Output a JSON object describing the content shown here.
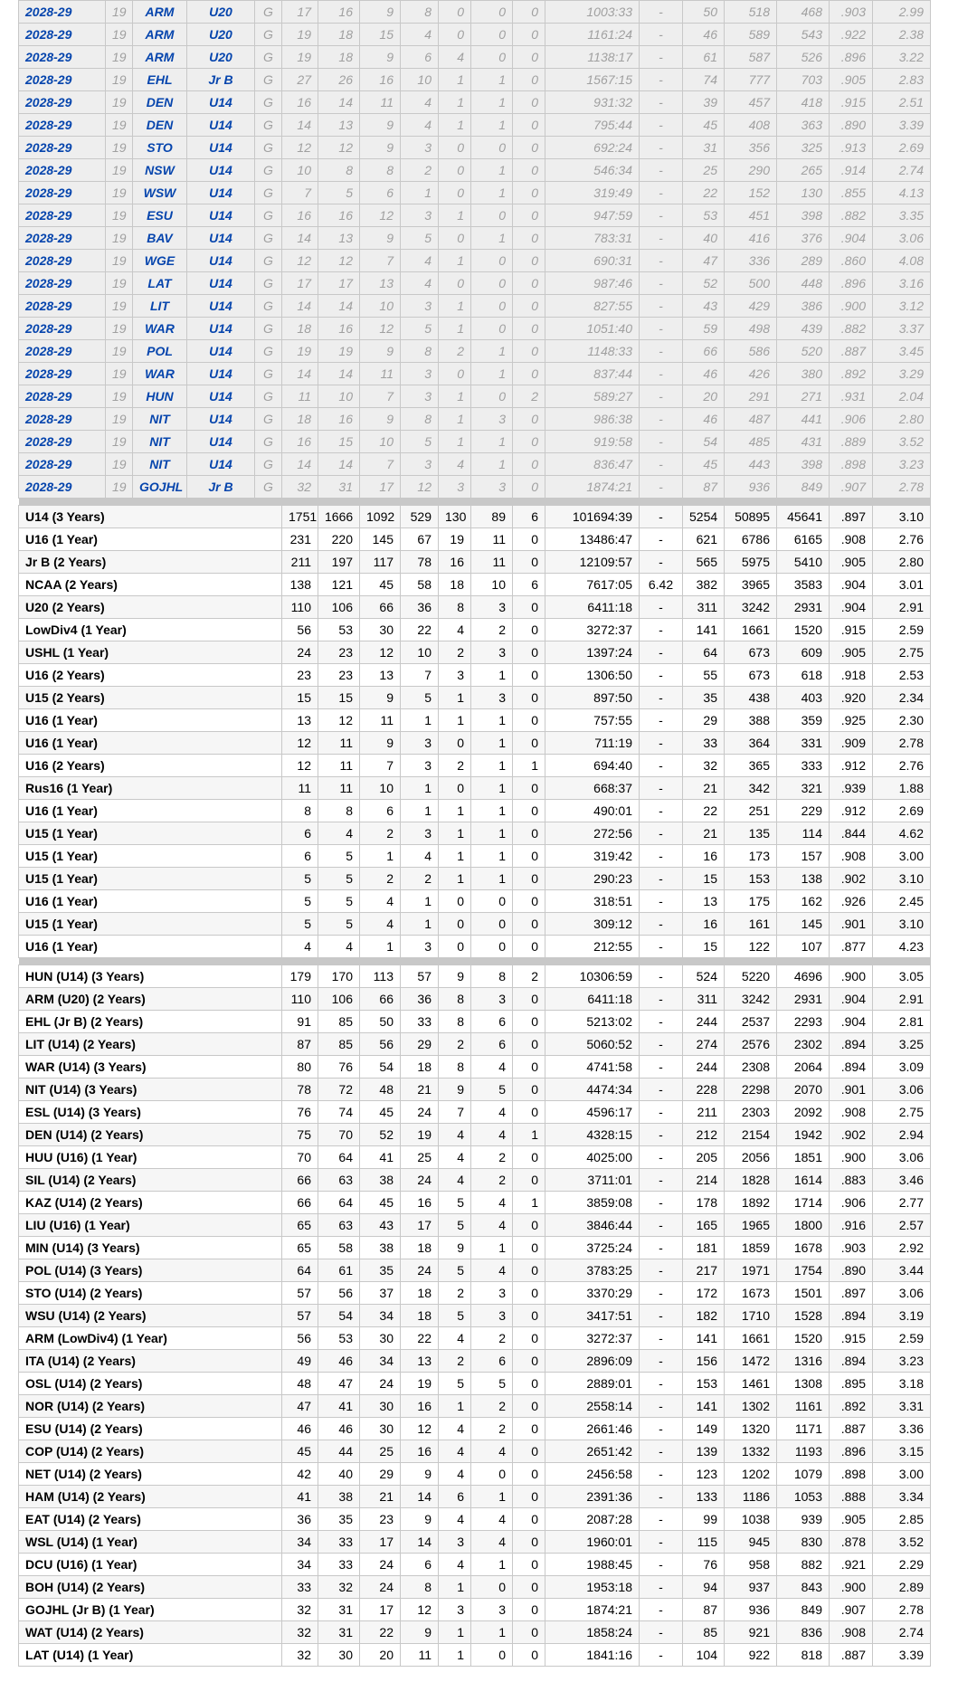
{
  "season_rows": [
    [
      "2028-29",
      "19",
      "ARM",
      "U20",
      "G",
      "17",
      "16",
      "9",
      "8",
      "0",
      "0",
      "0",
      "1003:33",
      "-",
      "50",
      "518",
      "468",
      ".903",
      "2.99"
    ],
    [
      "2028-29",
      "19",
      "ARM",
      "U20",
      "G",
      "19",
      "18",
      "15",
      "4",
      "0",
      "0",
      "0",
      "1161:24",
      "-",
      "46",
      "589",
      "543",
      ".922",
      "2.38"
    ],
    [
      "2028-29",
      "19",
      "ARM",
      "U20",
      "G",
      "19",
      "18",
      "9",
      "6",
      "4",
      "0",
      "0",
      "1138:17",
      "-",
      "61",
      "587",
      "526",
      ".896",
      "3.22"
    ],
    [
      "2028-29",
      "19",
      "EHL",
      "Jr B",
      "G",
      "27",
      "26",
      "16",
      "10",
      "1",
      "1",
      "0",
      "1567:15",
      "-",
      "74",
      "777",
      "703",
      ".905",
      "2.83"
    ],
    [
      "2028-29",
      "19",
      "DEN",
      "U14",
      "G",
      "16",
      "14",
      "11",
      "4",
      "1",
      "1",
      "0",
      "931:32",
      "-",
      "39",
      "457",
      "418",
      ".915",
      "2.51"
    ],
    [
      "2028-29",
      "19",
      "DEN",
      "U14",
      "G",
      "14",
      "13",
      "9",
      "4",
      "1",
      "1",
      "0",
      "795:44",
      "-",
      "45",
      "408",
      "363",
      ".890",
      "3.39"
    ],
    [
      "2028-29",
      "19",
      "STO",
      "U14",
      "G",
      "12",
      "12",
      "9",
      "3",
      "0",
      "0",
      "0",
      "692:24",
      "-",
      "31",
      "356",
      "325",
      ".913",
      "2.69"
    ],
    [
      "2028-29",
      "19",
      "NSW",
      "U14",
      "G",
      "10",
      "8",
      "8",
      "2",
      "0",
      "1",
      "0",
      "546:34",
      "-",
      "25",
      "290",
      "265",
      ".914",
      "2.74"
    ],
    [
      "2028-29",
      "19",
      "WSW",
      "U14",
      "G",
      "7",
      "5",
      "6",
      "1",
      "0",
      "1",
      "0",
      "319:49",
      "-",
      "22",
      "152",
      "130",
      ".855",
      "4.13"
    ],
    [
      "2028-29",
      "19",
      "ESU",
      "U14",
      "G",
      "16",
      "16",
      "12",
      "3",
      "1",
      "0",
      "0",
      "947:59",
      "-",
      "53",
      "451",
      "398",
      ".882",
      "3.35"
    ],
    [
      "2028-29",
      "19",
      "BAV",
      "U14",
      "G",
      "14",
      "13",
      "9",
      "5",
      "0",
      "1",
      "0",
      "783:31",
      "-",
      "40",
      "416",
      "376",
      ".904",
      "3.06"
    ],
    [
      "2028-29",
      "19",
      "WGE",
      "U14",
      "G",
      "12",
      "12",
      "7",
      "4",
      "1",
      "0",
      "0",
      "690:31",
      "-",
      "47",
      "336",
      "289",
      ".860",
      "4.08"
    ],
    [
      "2028-29",
      "19",
      "LAT",
      "U14",
      "G",
      "17",
      "17",
      "13",
      "4",
      "0",
      "0",
      "0",
      "987:46",
      "-",
      "52",
      "500",
      "448",
      ".896",
      "3.16"
    ],
    [
      "2028-29",
      "19",
      "LIT",
      "U14",
      "G",
      "14",
      "14",
      "10",
      "3",
      "1",
      "0",
      "0",
      "827:55",
      "-",
      "43",
      "429",
      "386",
      ".900",
      "3.12"
    ],
    [
      "2028-29",
      "19",
      "WAR",
      "U14",
      "G",
      "18",
      "16",
      "12",
      "5",
      "1",
      "0",
      "0",
      "1051:40",
      "-",
      "59",
      "498",
      "439",
      ".882",
      "3.37"
    ],
    [
      "2028-29",
      "19",
      "POL",
      "U14",
      "G",
      "19",
      "19",
      "9",
      "8",
      "2",
      "1",
      "0",
      "1148:33",
      "-",
      "66",
      "586",
      "520",
      ".887",
      "3.45"
    ],
    [
      "2028-29",
      "19",
      "WAR",
      "U14",
      "G",
      "14",
      "14",
      "11",
      "3",
      "0",
      "1",
      "0",
      "837:44",
      "-",
      "46",
      "426",
      "380",
      ".892",
      "3.29"
    ],
    [
      "2028-29",
      "19",
      "HUN",
      "U14",
      "G",
      "11",
      "10",
      "7",
      "3",
      "1",
      "0",
      "2",
      "589:27",
      "-",
      "20",
      "291",
      "271",
      ".931",
      "2.04"
    ],
    [
      "2028-29",
      "19",
      "NIT",
      "U14",
      "G",
      "18",
      "16",
      "9",
      "8",
      "1",
      "3",
      "0",
      "986:38",
      "-",
      "46",
      "487",
      "441",
      ".906",
      "2.80"
    ],
    [
      "2028-29",
      "19",
      "NIT",
      "U14",
      "G",
      "16",
      "15",
      "10",
      "5",
      "1",
      "1",
      "0",
      "919:58",
      "-",
      "54",
      "485",
      "431",
      ".889",
      "3.52"
    ],
    [
      "2028-29",
      "19",
      "NIT",
      "U14",
      "G",
      "14",
      "14",
      "7",
      "3",
      "4",
      "1",
      "0",
      "836:47",
      "-",
      "45",
      "443",
      "398",
      ".898",
      "3.23"
    ],
    [
      "2028-29",
      "19",
      "GOJHL",
      "Jr B",
      "G",
      "32",
      "31",
      "17",
      "12",
      "3",
      "3",
      "0",
      "1874:21",
      "-",
      "87",
      "936",
      "849",
      ".907",
      "2.78"
    ]
  ],
  "league_totals": [
    [
      "U14 (3 Years)",
      "1751",
      "1666",
      "1092",
      "529",
      "130",
      "89",
      "6",
      "101694:39",
      "-",
      "5254",
      "50895",
      "45641",
      ".897",
      "3.10"
    ],
    [
      "U16 (1 Year)",
      "231",
      "220",
      "145",
      "67",
      "19",
      "11",
      "0",
      "13486:47",
      "-",
      "621",
      "6786",
      "6165",
      ".908",
      "2.76"
    ],
    [
      "Jr B (2 Years)",
      "211",
      "197",
      "117",
      "78",
      "16",
      "11",
      "0",
      "12109:57",
      "-",
      "565",
      "5975",
      "5410",
      ".905",
      "2.80"
    ],
    [
      "NCAA (2 Years)",
      "138",
      "121",
      "45",
      "58",
      "18",
      "10",
      "6",
      "7617:05",
      "6.42",
      "382",
      "3965",
      "3583",
      ".904",
      "3.01"
    ],
    [
      "U20 (2 Years)",
      "110",
      "106",
      "66",
      "36",
      "8",
      "3",
      "0",
      "6411:18",
      "-",
      "311",
      "3242",
      "2931",
      ".904",
      "2.91"
    ],
    [
      "LowDiv4 (1 Year)",
      "56",
      "53",
      "30",
      "22",
      "4",
      "2",
      "0",
      "3272:37",
      "-",
      "141",
      "1661",
      "1520",
      ".915",
      "2.59"
    ],
    [
      "USHL (1 Year)",
      "24",
      "23",
      "12",
      "10",
      "2",
      "3",
      "0",
      "1397:24",
      "-",
      "64",
      "673",
      "609",
      ".905",
      "2.75"
    ],
    [
      "U16 (2 Years)",
      "23",
      "23",
      "13",
      "7",
      "3",
      "1",
      "0",
      "1306:50",
      "-",
      "55",
      "673",
      "618",
      ".918",
      "2.53"
    ],
    [
      "U15 (2 Years)",
      "15",
      "15",
      "9",
      "5",
      "1",
      "3",
      "0",
      "897:50",
      "-",
      "35",
      "438",
      "403",
      ".920",
      "2.34"
    ],
    [
      "U16 (1 Year)",
      "13",
      "12",
      "11",
      "1",
      "1",
      "1",
      "0",
      "757:55",
      "-",
      "29",
      "388",
      "359",
      ".925",
      "2.30"
    ],
    [
      "U16 (1 Year)",
      "12",
      "11",
      "9",
      "3",
      "0",
      "1",
      "0",
      "711:19",
      "-",
      "33",
      "364",
      "331",
      ".909",
      "2.78"
    ],
    [
      "U16 (2 Years)",
      "12",
      "11",
      "7",
      "3",
      "2",
      "1",
      "1",
      "694:40",
      "-",
      "32",
      "365",
      "333",
      ".912",
      "2.76"
    ],
    [
      "Rus16 (1 Year)",
      "11",
      "11",
      "10",
      "1",
      "0",
      "1",
      "0",
      "668:37",
      "-",
      "21",
      "342",
      "321",
      ".939",
      "1.88"
    ],
    [
      "U16 (1 Year)",
      "8",
      "8",
      "6",
      "1",
      "1",
      "1",
      "0",
      "490:01",
      "-",
      "22",
      "251",
      "229",
      ".912",
      "2.69"
    ],
    [
      "U15 (1 Year)",
      "6",
      "4",
      "2",
      "3",
      "1",
      "1",
      "0",
      "272:56",
      "-",
      "21",
      "135",
      "114",
      ".844",
      "4.62"
    ],
    [
      "U15 (1 Year)",
      "6",
      "5",
      "1",
      "4",
      "1",
      "1",
      "0",
      "319:42",
      "-",
      "16",
      "173",
      "157",
      ".908",
      "3.00"
    ],
    [
      "U15 (1 Year)",
      "5",
      "5",
      "2",
      "2",
      "1",
      "1",
      "0",
      "290:23",
      "-",
      "15",
      "153",
      "138",
      ".902",
      "3.10"
    ],
    [
      "U16 (1 Year)",
      "5",
      "5",
      "4",
      "1",
      "0",
      "0",
      "0",
      "318:51",
      "-",
      "13",
      "175",
      "162",
      ".926",
      "2.45"
    ],
    [
      "U15 (1 Year)",
      "5",
      "5",
      "4",
      "1",
      "0",
      "0",
      "0",
      "309:12",
      "-",
      "16",
      "161",
      "145",
      ".901",
      "3.10"
    ],
    [
      "U16 (1 Year)",
      "4",
      "4",
      "1",
      "3",
      "0",
      "0",
      "0",
      "212:55",
      "-",
      "15",
      "122",
      "107",
      ".877",
      "4.23"
    ]
  ],
  "team_totals": [
    [
      "HUN (U14) (3 Years)",
      "179",
      "170",
      "113",
      "57",
      "9",
      "8",
      "2",
      "10306:59",
      "-",
      "524",
      "5220",
      "4696",
      ".900",
      "3.05"
    ],
    [
      "ARM (U20) (2 Years)",
      "110",
      "106",
      "66",
      "36",
      "8",
      "3",
      "0",
      "6411:18",
      "-",
      "311",
      "3242",
      "2931",
      ".904",
      "2.91"
    ],
    [
      "EHL (Jr B) (2 Years)",
      "91",
      "85",
      "50",
      "33",
      "8",
      "6",
      "0",
      "5213:02",
      "-",
      "244",
      "2537",
      "2293",
      ".904",
      "2.81"
    ],
    [
      "LIT (U14) (2 Years)",
      "87",
      "85",
      "56",
      "29",
      "2",
      "6",
      "0",
      "5060:52",
      "-",
      "274",
      "2576",
      "2302",
      ".894",
      "3.25"
    ],
    [
      "WAR (U14) (3 Years)",
      "80",
      "76",
      "54",
      "18",
      "8",
      "4",
      "0",
      "4741:58",
      "-",
      "244",
      "2308",
      "2064",
      ".894",
      "3.09"
    ],
    [
      "NIT (U14) (3 Years)",
      "78",
      "72",
      "48",
      "21",
      "9",
      "5",
      "0",
      "4474:34",
      "-",
      "228",
      "2298",
      "2070",
      ".901",
      "3.06"
    ],
    [
      "ESL (U14) (3 Years)",
      "76",
      "74",
      "45",
      "24",
      "7",
      "4",
      "0",
      "4596:17",
      "-",
      "211",
      "2303",
      "2092",
      ".908",
      "2.75"
    ],
    [
      "DEN (U14) (2 Years)",
      "75",
      "70",
      "52",
      "19",
      "4",
      "4",
      "1",
      "4328:15",
      "-",
      "212",
      "2154",
      "1942",
      ".902",
      "2.94"
    ],
    [
      "HUU (U16) (1 Year)",
      "70",
      "64",
      "41",
      "25",
      "4",
      "2",
      "0",
      "4025:00",
      "-",
      "205",
      "2056",
      "1851",
      ".900",
      "3.06"
    ],
    [
      "SIL (U14) (2 Years)",
      "66",
      "63",
      "38",
      "24",
      "4",
      "2",
      "0",
      "3711:01",
      "-",
      "214",
      "1828",
      "1614",
      ".883",
      "3.46"
    ],
    [
      "KAZ (U14) (2 Years)",
      "66",
      "64",
      "45",
      "16",
      "5",
      "4",
      "1",
      "3859:08",
      "-",
      "178",
      "1892",
      "1714",
      ".906",
      "2.77"
    ],
    [
      "LIU (U16) (1 Year)",
      "65",
      "63",
      "43",
      "17",
      "5",
      "4",
      "0",
      "3846:44",
      "-",
      "165",
      "1965",
      "1800",
      ".916",
      "2.57"
    ],
    [
      "MIN (U14) (3 Years)",
      "65",
      "58",
      "38",
      "18",
      "9",
      "1",
      "0",
      "3725:24",
      "-",
      "181",
      "1859",
      "1678",
      ".903",
      "2.92"
    ],
    [
      "POL (U14) (3 Years)",
      "64",
      "61",
      "35",
      "24",
      "5",
      "4",
      "0",
      "3783:25",
      "-",
      "217",
      "1971",
      "1754",
      ".890",
      "3.44"
    ],
    [
      "STO (U14) (2 Years)",
      "57",
      "56",
      "37",
      "18",
      "2",
      "3",
      "0",
      "3370:29",
      "-",
      "172",
      "1673",
      "1501",
      ".897",
      "3.06"
    ],
    [
      "WSU (U14) (2 Years)",
      "57",
      "54",
      "34",
      "18",
      "5",
      "3",
      "0",
      "3417:51",
      "-",
      "182",
      "1710",
      "1528",
      ".894",
      "3.19"
    ],
    [
      "ARM (LowDiv4) (1 Year)",
      "56",
      "53",
      "30",
      "22",
      "4",
      "2",
      "0",
      "3272:37",
      "-",
      "141",
      "1661",
      "1520",
      ".915",
      "2.59"
    ],
    [
      "ITA (U14) (2 Years)",
      "49",
      "46",
      "34",
      "13",
      "2",
      "6",
      "0",
      "2896:09",
      "-",
      "156",
      "1472",
      "1316",
      ".894",
      "3.23"
    ],
    [
      "OSL (U14) (2 Years)",
      "48",
      "47",
      "24",
      "19",
      "5",
      "5",
      "0",
      "2889:01",
      "-",
      "153",
      "1461",
      "1308",
      ".895",
      "3.18"
    ],
    [
      "NOR (U14) (2 Years)",
      "47",
      "41",
      "30",
      "16",
      "1",
      "2",
      "0",
      "2558:14",
      "-",
      "141",
      "1302",
      "1161",
      ".892",
      "3.31"
    ],
    [
      "ESU (U14) (2 Years)",
      "46",
      "46",
      "30",
      "12",
      "4",
      "2",
      "0",
      "2661:46",
      "-",
      "149",
      "1320",
      "1171",
      ".887",
      "3.36"
    ],
    [
      "COP (U14) (2 Years)",
      "45",
      "44",
      "25",
      "16",
      "4",
      "4",
      "0",
      "2651:42",
      "-",
      "139",
      "1332",
      "1193",
      ".896",
      "3.15"
    ],
    [
      "NET (U14) (2 Years)",
      "42",
      "40",
      "29",
      "9",
      "4",
      "0",
      "0",
      "2456:58",
      "-",
      "123",
      "1202",
      "1079",
      ".898",
      "3.00"
    ],
    [
      "HAM (U14) (2 Years)",
      "41",
      "38",
      "21",
      "14",
      "6",
      "1",
      "0",
      "2391:36",
      "-",
      "133",
      "1186",
      "1053",
      ".888",
      "3.34"
    ],
    [
      "EAT (U14) (2 Years)",
      "36",
      "35",
      "23",
      "9",
      "4",
      "4",
      "0",
      "2087:28",
      "-",
      "99",
      "1038",
      "939",
      ".905",
      "2.85"
    ],
    [
      "WSL (U14) (1 Year)",
      "34",
      "33",
      "17",
      "14",
      "3",
      "4",
      "0",
      "1960:01",
      "-",
      "115",
      "945",
      "830",
      ".878",
      "3.52"
    ],
    [
      "DCU (U16) (1 Year)",
      "34",
      "33",
      "24",
      "6",
      "4",
      "1",
      "0",
      "1988:45",
      "-",
      "76",
      "958",
      "882",
      ".921",
      "2.29"
    ],
    [
      "BOH (U14) (2 Years)",
      "33",
      "32",
      "24",
      "8",
      "1",
      "0",
      "0",
      "1953:18",
      "-",
      "94",
      "937",
      "843",
      ".900",
      "2.89"
    ],
    [
      "GOJHL (Jr B) (1 Year)",
      "32",
      "31",
      "17",
      "12",
      "3",
      "3",
      "0",
      "1874:21",
      "-",
      "87",
      "936",
      "849",
      ".907",
      "2.78"
    ],
    [
      "WAT (U14) (2 Years)",
      "32",
      "31",
      "22",
      "9",
      "1",
      "1",
      "0",
      "1858:24",
      "-",
      "85",
      "921",
      "836",
      ".908",
      "2.74"
    ],
    [
      "LAT (U14) (1 Year)",
      "32",
      "30",
      "20",
      "11",
      "1",
      "0",
      "0",
      "1841:16",
      "-",
      "104",
      "922",
      "818",
      ".887",
      "3.39"
    ]
  ]
}
